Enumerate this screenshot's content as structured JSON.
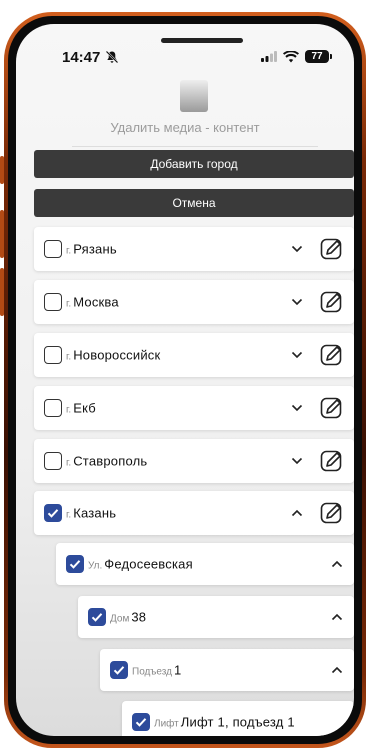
{
  "status_bar": {
    "time": "14:47",
    "battery": "77"
  },
  "header": {
    "delete_media_label": "Удалить медиа - контент"
  },
  "actions": {
    "add_city_label": "Добавить город",
    "cancel_label": "Отмена"
  },
  "cities": [
    {
      "prefix": "г.",
      "name": "Рязань",
      "checked": false,
      "expanded": false
    },
    {
      "prefix": "г.",
      "name": "Москва",
      "checked": false,
      "expanded": false
    },
    {
      "prefix": "г.",
      "name": "Новороссийск",
      "checked": false,
      "expanded": false
    },
    {
      "prefix": "г.",
      "name": "Екб",
      "checked": false,
      "expanded": false
    },
    {
      "prefix": "г.",
      "name": "Ставрополь",
      "checked": false,
      "expanded": false
    },
    {
      "prefix": "г.",
      "name": "Казань",
      "checked": true,
      "expanded": true
    }
  ],
  "tree": {
    "street": {
      "prefix": "Ул.",
      "name": "Федосеевская",
      "checked": true,
      "expanded": true
    },
    "house": {
      "prefix": "Дом",
      "name": "38",
      "checked": true,
      "expanded": true
    },
    "entrance": {
      "prefix": "Подъезд",
      "name": "1",
      "checked": true,
      "expanded": true
    },
    "elevator": {
      "prefix": "Лифт",
      "name": "Лифт 1, подъезд 1",
      "checked": true
    }
  },
  "colors": {
    "checkbox_checked": "#2d4b9b",
    "button_dark": "#3a3a3a",
    "phone_frame": "#b24a14"
  }
}
